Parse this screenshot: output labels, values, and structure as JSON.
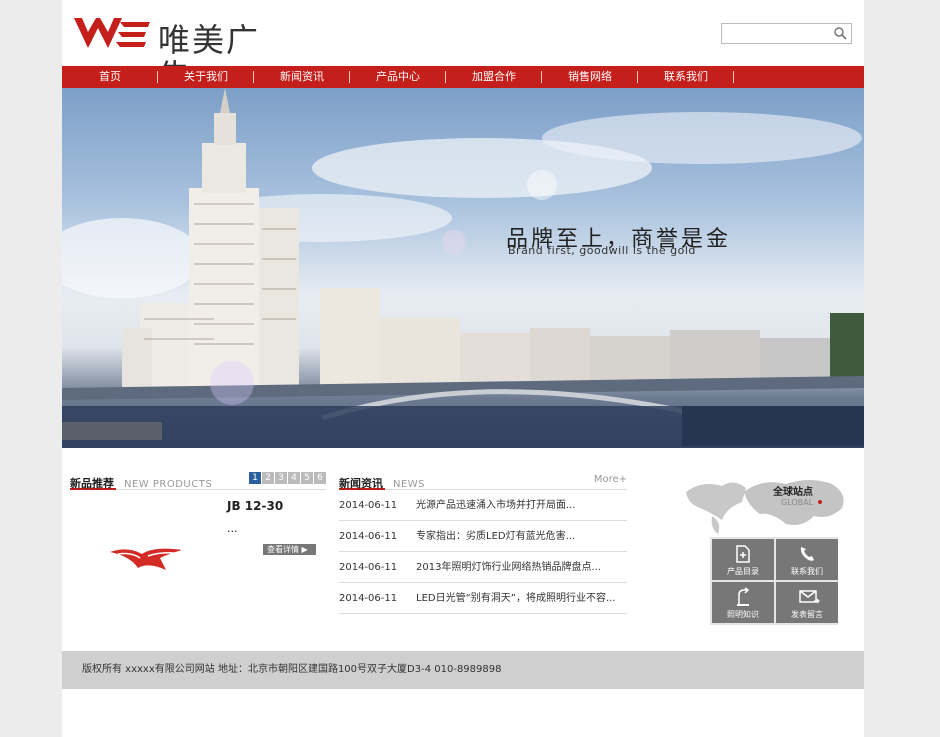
{
  "header": {
    "logo_text": "唯美广告",
    "search_placeholder": ""
  },
  "nav": [
    {
      "label": "首页"
    },
    {
      "label": "关于我们"
    },
    {
      "label": "新闻资讯"
    },
    {
      "label": "产品中心"
    },
    {
      "label": "加盟合作"
    },
    {
      "label": "销售网络"
    },
    {
      "label": "联系我们"
    }
  ],
  "banner": {
    "tagline": "品牌至上，商誉是金",
    "tagline_en": "Brand first, goodwill is the gold"
  },
  "products": {
    "title": "新品推荐",
    "subtitle": "NEW PRODUCTS",
    "pages": [
      "1",
      "2",
      "3",
      "4",
      "5",
      "6"
    ],
    "active_page": "1",
    "item_name": "JB 12-30",
    "item_desc": "...",
    "detail_label": "查看详情 ▶"
  },
  "news": {
    "title": "新闻资讯",
    "subtitle": "NEWS",
    "more": "More+",
    "items": [
      {
        "date": "2014-06-11",
        "title": "光源产品迅速涌入市场并打开局面..."
      },
      {
        "date": "2014-06-11",
        "title": "专家指出：劣质LED灯有蓝光危害..."
      },
      {
        "date": "2014-06-11",
        "title": "2013年照明灯饰行业网络热销品牌盘点..."
      },
      {
        "date": "2014-06-11",
        "title": "LED日光管“别有洞天”，将成照明行业不容..."
      }
    ]
  },
  "global": {
    "title": "全球站点",
    "subtitle": "GLOBAL"
  },
  "quick_links": [
    {
      "label": "产品目录",
      "icon": "catalog-icon"
    },
    {
      "label": "联系我们",
      "icon": "phone-icon"
    },
    {
      "label": "照明知识",
      "icon": "knowledge-icon"
    },
    {
      "label": "发表留言",
      "icon": "mail-icon"
    }
  ],
  "footer": {
    "text": "版权所有 xxxxx有限公司网站 地址：北京市朝阳区建国路100号双子大厦D3-4 010-8989898"
  },
  "colors": {
    "brand_red": "#c41f1b",
    "pager_active": "#2b5f9e"
  }
}
